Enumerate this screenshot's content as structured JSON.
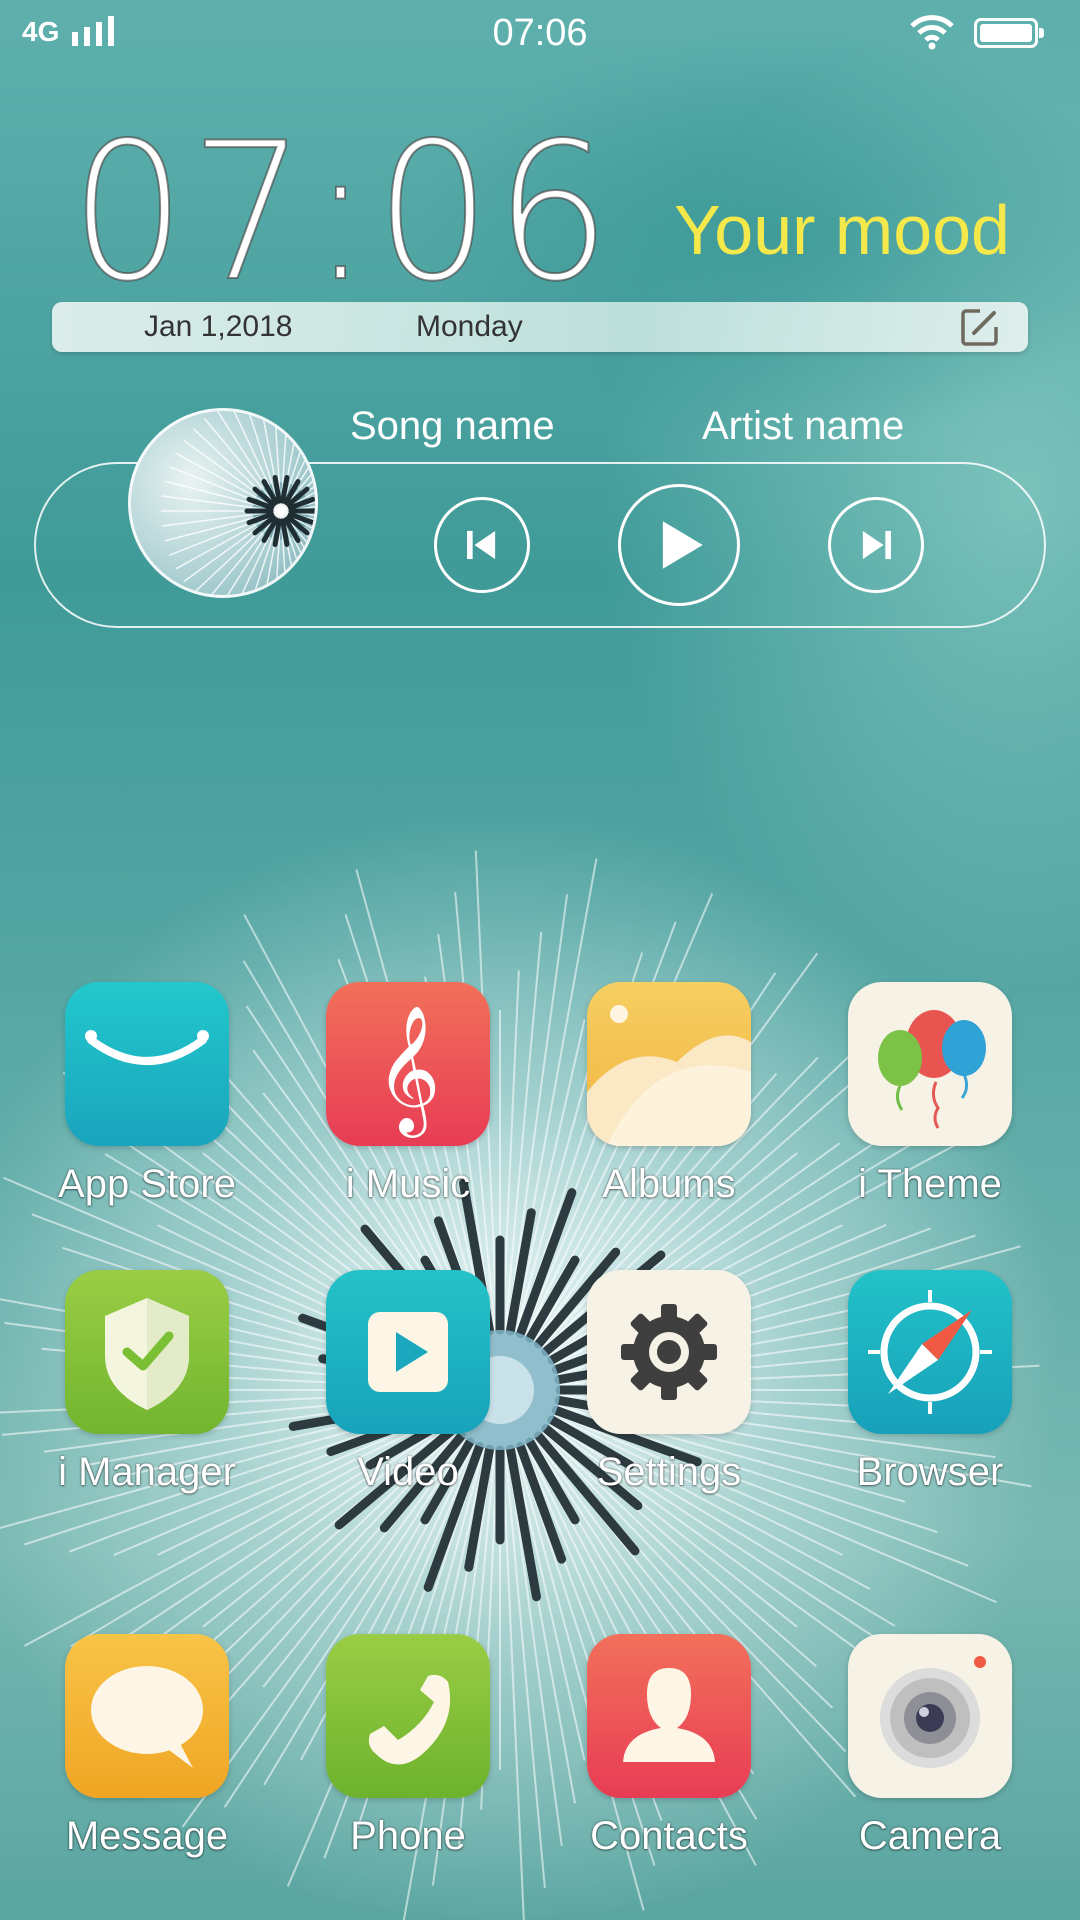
{
  "status_bar": {
    "network": "4G",
    "time": "07:06",
    "battery_level": 1.0,
    "signal_icon": "signal-bars-icon",
    "wifi_icon": "wifi-icon"
  },
  "clock_widget": {
    "time": "07:06",
    "mood": "Your mood",
    "date": "Jan 1,2018",
    "day": "Monday",
    "edit_icon": "edit-icon",
    "mood_color": "#f4e84b"
  },
  "music_widget": {
    "song": "Song name",
    "artist": "Artist name",
    "controls": [
      "previous-icon",
      "play-icon",
      "next-icon"
    ]
  },
  "apps": [
    {
      "label": "App Store",
      "icon": "app-store-icon",
      "color": "#1bb8c4"
    },
    {
      "label": "i Music",
      "icon": "music-note-icon",
      "color": "#ee4a55"
    },
    {
      "label": "Albums",
      "icon": "albums-icon",
      "color": "#f5c65a"
    },
    {
      "label": "i Theme",
      "icon": "balloons-icon",
      "color": "#f5f1e6"
    },
    {
      "label": "i Manager",
      "icon": "shield-icon",
      "color": "#86c43a"
    },
    {
      "label": "Video",
      "icon": "video-play-icon",
      "color": "#1bb0c0"
    },
    {
      "label": "Settings",
      "icon": "gear-icon",
      "color": "#f5f1e6"
    },
    {
      "label": "Browser",
      "icon": "compass-icon",
      "color": "#1bb0c0"
    },
    {
      "label": "Message",
      "icon": "chat-bubble-icon",
      "color": "#f5b431"
    },
    {
      "label": "Phone",
      "icon": "phone-icon",
      "color": "#86c43a"
    },
    {
      "label": "Contacts",
      "icon": "contact-person-icon",
      "color": "#ee4a55"
    },
    {
      "label": "Camera",
      "icon": "camera-icon",
      "color": "#f5f1e6"
    }
  ]
}
